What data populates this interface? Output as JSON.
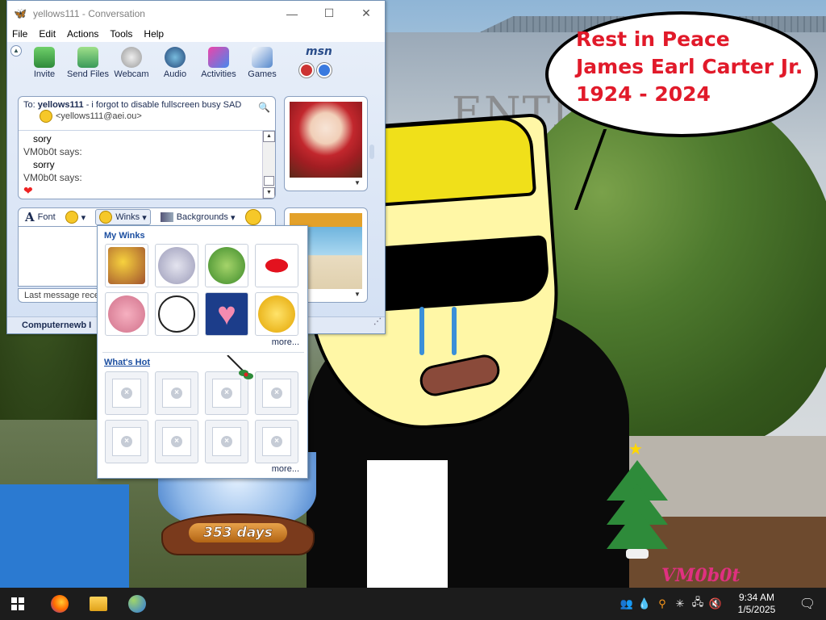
{
  "window": {
    "title": "yellows111 - Conversation",
    "minimize_label": "—",
    "maximize_label": "☐",
    "close_label": "✕",
    "menu": [
      "File",
      "Edit",
      "Actions",
      "Tools",
      "Help"
    ]
  },
  "toolbar": {
    "items": [
      "Invite",
      "Send Files",
      "Webcam",
      "Audio",
      "Activities",
      "Games"
    ],
    "logo": "msn"
  },
  "conversation": {
    "to_label": "To:",
    "to_name": "yellows111",
    "to_message": " - i forgot to disable fullscreen busy SAD",
    "to_email": "<yellows111@aei.ou>",
    "lines": [
      {
        "kind": "msg",
        "text": "sory"
      },
      {
        "kind": "speaker",
        "text": "VM0b0t says:"
      },
      {
        "kind": "msg",
        "text": "sorry"
      },
      {
        "kind": "speaker",
        "text": "VM0b0t says:"
      }
    ]
  },
  "compose_toolbar": {
    "font_label": "Font",
    "winks_label": "Winks",
    "backgrounds_label": "Backgrounds"
  },
  "status": {
    "last_message": "Last message received",
    "footer_user": "Computernewb I"
  },
  "winks_popup": {
    "my_winks_title": "My Winks",
    "whats_hot_title": "What's Hot",
    "more_1": "more...",
    "more_2": "more...",
    "my_winks": [
      "chicken-wink",
      "fist-wink",
      "frog-wink",
      "kiss-wink",
      "pig-wink",
      "face-wink",
      "heart-wink",
      "smiley-wink"
    ],
    "hot_slots": 8
  },
  "wallpaper": {
    "bubble_lines": [
      "Rest in Peace",
      "James Earl Carter Jr.",
      "1924 - 2024"
    ],
    "building_word": "ENTIAL",
    "snowglobe_label": "353 days",
    "signature": "VM0b0t"
  },
  "taskbar": {
    "apps": [
      "firefox",
      "file-explorer",
      "msn-messenger"
    ],
    "time": "9:34 AM",
    "date": "1/5/2025"
  },
  "colors": {
    "bubble_text": "#e11a2a",
    "msn_blue": "#1b2b52",
    "taskbar": "#1c1c1c"
  }
}
